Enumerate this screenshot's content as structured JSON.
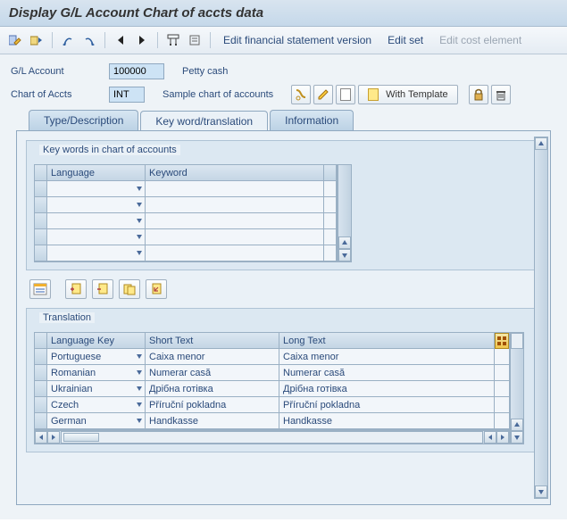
{
  "title": "Display G/L Account Chart of accts data",
  "toolbar_links": {
    "edit_fsv": "Edit financial statement version",
    "edit_set": "Edit set",
    "edit_cost": "Edit cost element"
  },
  "form": {
    "gl_label": "G/L Account",
    "gl_value": "100000",
    "gl_desc": "Petty cash",
    "coa_label": "Chart of Accts",
    "coa_value": "INT",
    "coa_desc": "Sample chart of accounts",
    "with_template": "With Template"
  },
  "tabs": {
    "type_desc": "Type/Description",
    "keyword": "Key word/translation",
    "info": "Information"
  },
  "group1": {
    "title": "Key words in chart of accounts",
    "col_lang": "Language",
    "col_kw": "Keyword"
  },
  "group2": {
    "title": "Translation",
    "col_langkey": "Language Key",
    "col_short": "Short Text",
    "col_long": "Long Text",
    "rows": [
      {
        "lang": "Portuguese",
        "short": "Caixa menor",
        "long": "Caixa menor"
      },
      {
        "lang": "Romanian",
        "short": "Numerar casă",
        "long": "Numerar casă"
      },
      {
        "lang": "Ukrainian",
        "short": "Дрібна готівка",
        "long": "Дрібна готівка"
      },
      {
        "lang": "Czech",
        "short": "Příruční pokladna",
        "long": "Příruční pokladna"
      },
      {
        "lang": "German",
        "short": "Handkasse",
        "long": "Handkasse"
      }
    ]
  }
}
